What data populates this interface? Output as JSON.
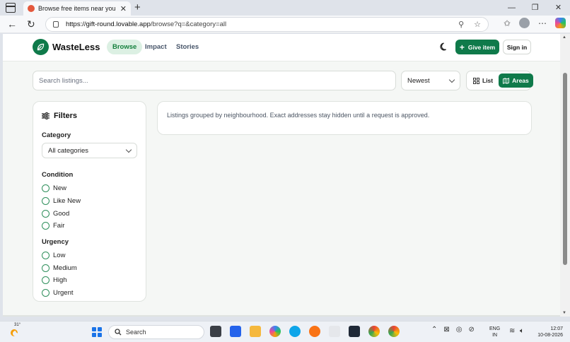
{
  "browser": {
    "tab_title": "Browse free items near you — Wa",
    "url_host": "https://gift-round.lovable.app",
    "url_path": "/browse?q=&category=all"
  },
  "app": {
    "name": "WasteLess",
    "nav": [
      {
        "label": "Browse",
        "active": true
      },
      {
        "label": "Impact",
        "active": false
      },
      {
        "label": "Stories",
        "active": false
      }
    ],
    "give_label": "Give item",
    "signin_label": "Sign in"
  },
  "toolbar": {
    "search_placeholder": "Search listings...",
    "sort_value": "Newest",
    "view_list_label": "List",
    "view_areas_label": "Areas"
  },
  "filters": {
    "title": "Filters",
    "category_label": "Category",
    "category_value": "All categories",
    "condition_label": "Condition",
    "conditions": [
      "New",
      "Like New",
      "Good",
      "Fair"
    ],
    "urgency_label": "Urgency",
    "urgencies": [
      "Low",
      "Medium",
      "High",
      "Urgent"
    ]
  },
  "notice": "Listings grouped by neighbourhood. Exact addresses stay hidden until a request is approved.",
  "taskbar": {
    "temp": "31°",
    "search_label": "Search",
    "lang_top": "ENG",
    "lang_bottom": "IN",
    "time": "12:07",
    "date": "10-08-2026"
  },
  "colors": {
    "brand": "#0f7a4a",
    "active_nav_bg": "#dcf0e3",
    "page_bg": "#f5f7f5"
  }
}
